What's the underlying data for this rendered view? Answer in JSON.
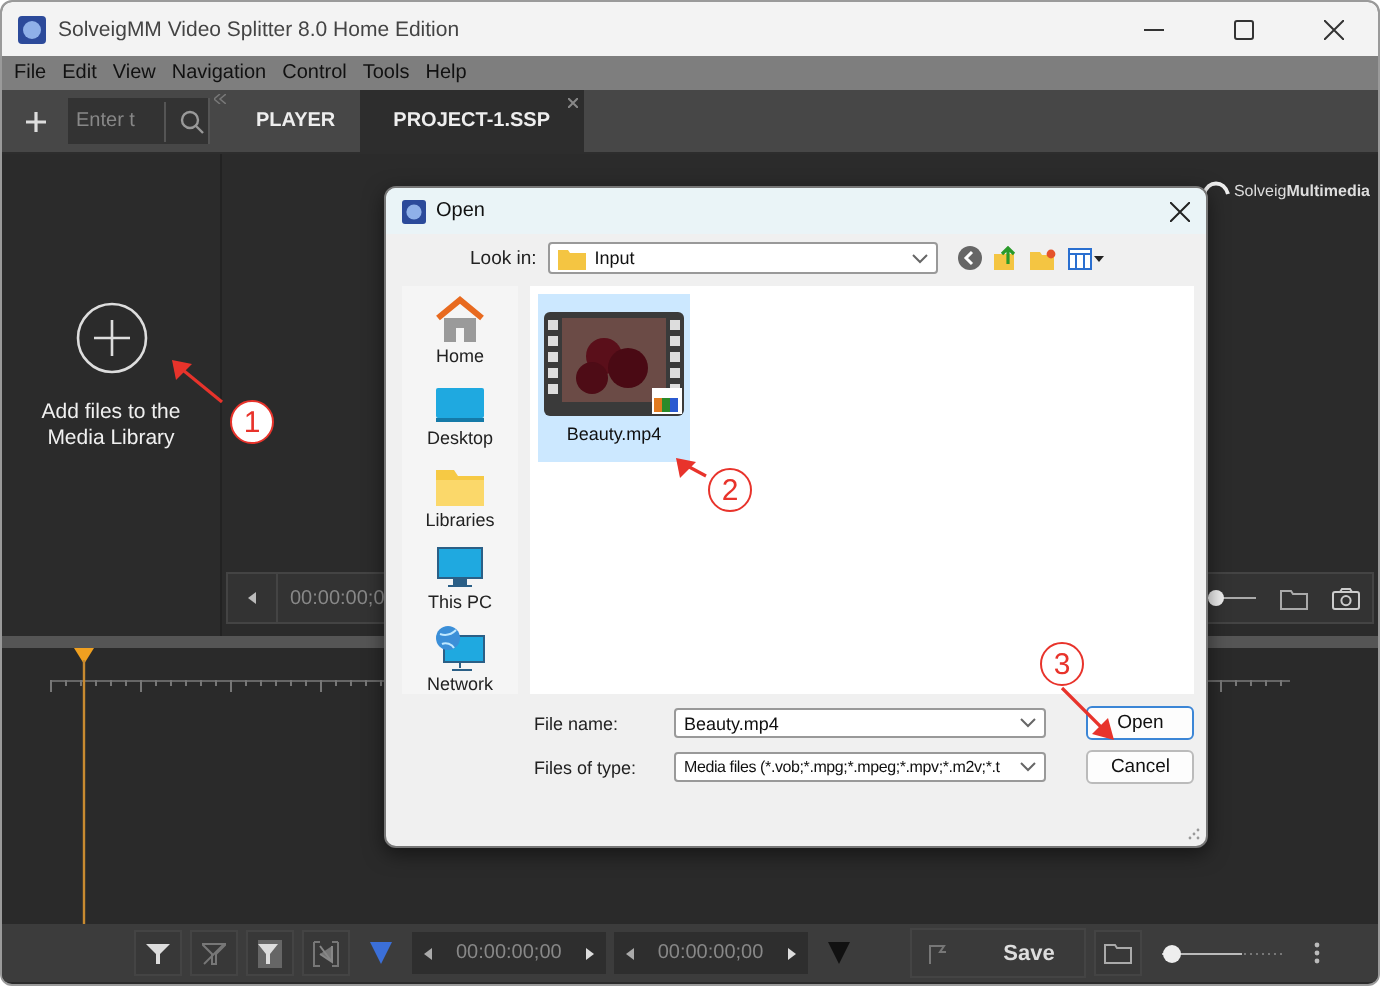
{
  "window": {
    "title": "SolveigMM Video Splitter 8.0 Home Edition"
  },
  "menu": [
    "File",
    "Edit",
    "View",
    "Navigation",
    "Control",
    "Tools",
    "Help"
  ],
  "search": {
    "placeholder": "Enter t"
  },
  "tabs": [
    {
      "label": "PLAYER",
      "selected": false
    },
    {
      "label": "PROJECT-1.SSP",
      "selected": true
    }
  ],
  "media_library": {
    "label": "Add files to the Media Library"
  },
  "brand": "Solveig**Multimedia**",
  "player_bar": {
    "timecode": "00:00:00;0"
  },
  "bottom_toolbar": {
    "timecodes": [
      "00:00:00;00",
      "00:00:00;00"
    ],
    "save": "Save"
  },
  "dialog": {
    "title": "Open",
    "look_in_label": "Look in:",
    "look_in": "Input",
    "places": [
      {
        "label": "Home",
        "kind": "home"
      },
      {
        "label": "Desktop",
        "kind": "desktop"
      },
      {
        "label": "Libraries",
        "kind": "folder"
      },
      {
        "label": "This PC",
        "kind": "pc"
      },
      {
        "label": "Network",
        "kind": "network"
      }
    ],
    "files": [
      {
        "name": "Beauty.mp4",
        "selected": true
      }
    ],
    "file_name_label": "File name:",
    "file_name": "Beauty.mp4",
    "file_type_label": "Files of type:",
    "file_type": "Media files (*.vob;*.mpg;*.mpeg;*.mpv;*.m2v;*.t",
    "buttons": [
      "Open",
      "Cancel"
    ]
  },
  "annotations": [
    "1",
    "2",
    "3"
  ]
}
